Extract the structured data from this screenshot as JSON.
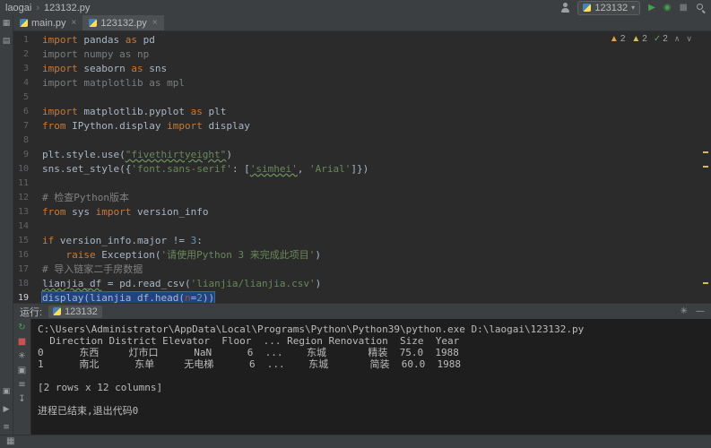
{
  "glyphs": {
    "close": "×",
    "caret": "▾",
    "play": "▶",
    "bug": "◉",
    "stop": "■",
    "gear": "✳",
    "minimize": "—",
    "separator": "›",
    "grid": "▦"
  },
  "titlebar": {
    "project": "laogai",
    "file": "123132.py",
    "run_config": "123132"
  },
  "tabs": [
    {
      "label": "main.py",
      "active": false
    },
    {
      "label": "123132.py",
      "active": true
    }
  ],
  "left_strip": {
    "top": [
      {
        "name": "project-tool-icon",
        "glyph": "▦"
      },
      {
        "name": "structure-tool-icon",
        "glyph": "▤"
      }
    ],
    "bottom": [
      {
        "name": "favorites-tool-icon",
        "glyph": "▣"
      },
      {
        "name": "run-tool-window-icon",
        "glyph": "▶"
      },
      {
        "name": "terminal-tool-icon",
        "glyph": "≡"
      }
    ]
  },
  "inspections": {
    "items": [
      {
        "name": "warning",
        "icon": "▲",
        "count": "2",
        "color": "#e8a33d"
      },
      {
        "name": "weak-warning",
        "icon": "▲",
        "count": "2",
        "color": "#d6bf55"
      },
      {
        "name": "typo",
        "icon": "✓",
        "count": "2",
        "color": "#5f9e5b"
      }
    ],
    "prev": "∧",
    "next": "∨"
  },
  "editor": {
    "lines": [
      {
        "n": "1",
        "segs": [
          [
            "kw",
            "import"
          ],
          [
            "id",
            " pandas "
          ],
          [
            "kw",
            "as"
          ],
          [
            "id",
            " pd"
          ]
        ]
      },
      {
        "n": "2",
        "segs": [
          [
            "gray",
            "import numpy as np"
          ]
        ]
      },
      {
        "n": "3",
        "segs": [
          [
            "kw",
            "import"
          ],
          [
            "id",
            " seaborn "
          ],
          [
            "kw",
            "as"
          ],
          [
            "id",
            " sns"
          ]
        ]
      },
      {
        "n": "4",
        "segs": [
          [
            "gray",
            "import matplotlib as mpl"
          ]
        ]
      },
      {
        "n": "5",
        "segs": []
      },
      {
        "n": "6",
        "segs": [
          [
            "kw",
            "import"
          ],
          [
            "id",
            " matplotlib.pyplot "
          ],
          [
            "kw",
            "as"
          ],
          [
            "id",
            " plt"
          ]
        ]
      },
      {
        "n": "7",
        "segs": [
          [
            "kw",
            "from"
          ],
          [
            "id",
            " IPython.display "
          ],
          [
            "kw",
            "import"
          ],
          [
            "id",
            " display"
          ]
        ]
      },
      {
        "n": "8",
        "segs": []
      },
      {
        "n": "9",
        "segs": [
          [
            "id",
            "plt.style.use("
          ],
          [
            "strU",
            "\"fivethirtyeight\""
          ],
          [
            "id",
            ")"
          ]
        ]
      },
      {
        "n": "10",
        "segs": [
          [
            "id",
            "sns.set_style({"
          ],
          [
            "str",
            "'font.sans-serif'"
          ],
          [
            "id",
            ": ["
          ],
          [
            "strU",
            "'simhei'"
          ],
          [
            "id",
            ", "
          ],
          [
            "str",
            "'Arial'"
          ],
          [
            "id",
            "]})"
          ]
        ]
      },
      {
        "n": "11",
        "segs": []
      },
      {
        "n": "12",
        "segs": [
          [
            "com",
            "# 检查Python版本"
          ]
        ]
      },
      {
        "n": "13",
        "segs": [
          [
            "kw",
            "from"
          ],
          [
            "id",
            " sys "
          ],
          [
            "kw",
            "import"
          ],
          [
            "id",
            " version_info"
          ]
        ]
      },
      {
        "n": "14",
        "segs": []
      },
      {
        "n": "15",
        "segs": [
          [
            "kw",
            "if"
          ],
          [
            "id",
            " version_info.major != "
          ],
          [
            "num",
            "3"
          ],
          [
            "id",
            ":"
          ]
        ]
      },
      {
        "n": "16",
        "segs": [
          [
            "id",
            "    "
          ],
          [
            "kw",
            "raise"
          ],
          [
            "id",
            " Exception("
          ],
          [
            "str",
            "'请使用Python 3 来完成此项目'"
          ],
          [
            "id",
            ")"
          ]
        ]
      },
      {
        "n": "17",
        "segs": [
          [
            "com",
            "# 导入链家二手房数据"
          ]
        ]
      },
      {
        "n": "18",
        "segs": [
          [
            "typo",
            "lianjia_df"
          ],
          [
            "id",
            " = pd.read_csv("
          ],
          [
            "str",
            "'lianjia/lianjia.csv'"
          ],
          [
            "id",
            ")"
          ]
        ]
      },
      {
        "n": "19",
        "caret": true,
        "sel": true,
        "segs": [
          [
            "id",
            "display(lianjia_df.head("
          ],
          [
            "prm",
            "n"
          ],
          [
            "id",
            "="
          ],
          [
            "num",
            "2"
          ],
          [
            "id",
            "))"
          ]
        ]
      }
    ]
  },
  "run_panel": {
    "title": "运行:",
    "tab_label": "123132",
    "toolbar": [
      {
        "name": "rerun-icon",
        "glyph": "↻",
        "color": "#499C54"
      },
      {
        "name": "stop-icon",
        "glyph": "■",
        "color": "#c75450"
      },
      {
        "name": "settings-icon",
        "glyph": "✳",
        "color": "#9da0a2"
      },
      {
        "name": "pin-icon",
        "glyph": "▣",
        "color": "#9da0a2"
      },
      {
        "name": "soft-wrap-icon",
        "glyph": "≡",
        "color": "#9da0a2"
      },
      {
        "name": "scroll-to-end-icon",
        "glyph": "↧",
        "color": "#9da0a2"
      }
    ],
    "console_lines": [
      "C:\\Users\\Administrator\\AppData\\Local\\Programs\\Python\\Python39\\python.exe D:\\laogai\\123132.py",
      "  Direction District Elevator  Floor  ... Region Renovation  Size  Year",
      "0      东西     灯市口      NaN      6  ...    东城       精装  75.0  1988",
      "1      南北      东单     无电梯      6  ...    东城       简装  60.0  1988",
      "",
      "[2 rows x 12 columns]",
      "",
      "进程已结束,退出代码0"
    ]
  }
}
